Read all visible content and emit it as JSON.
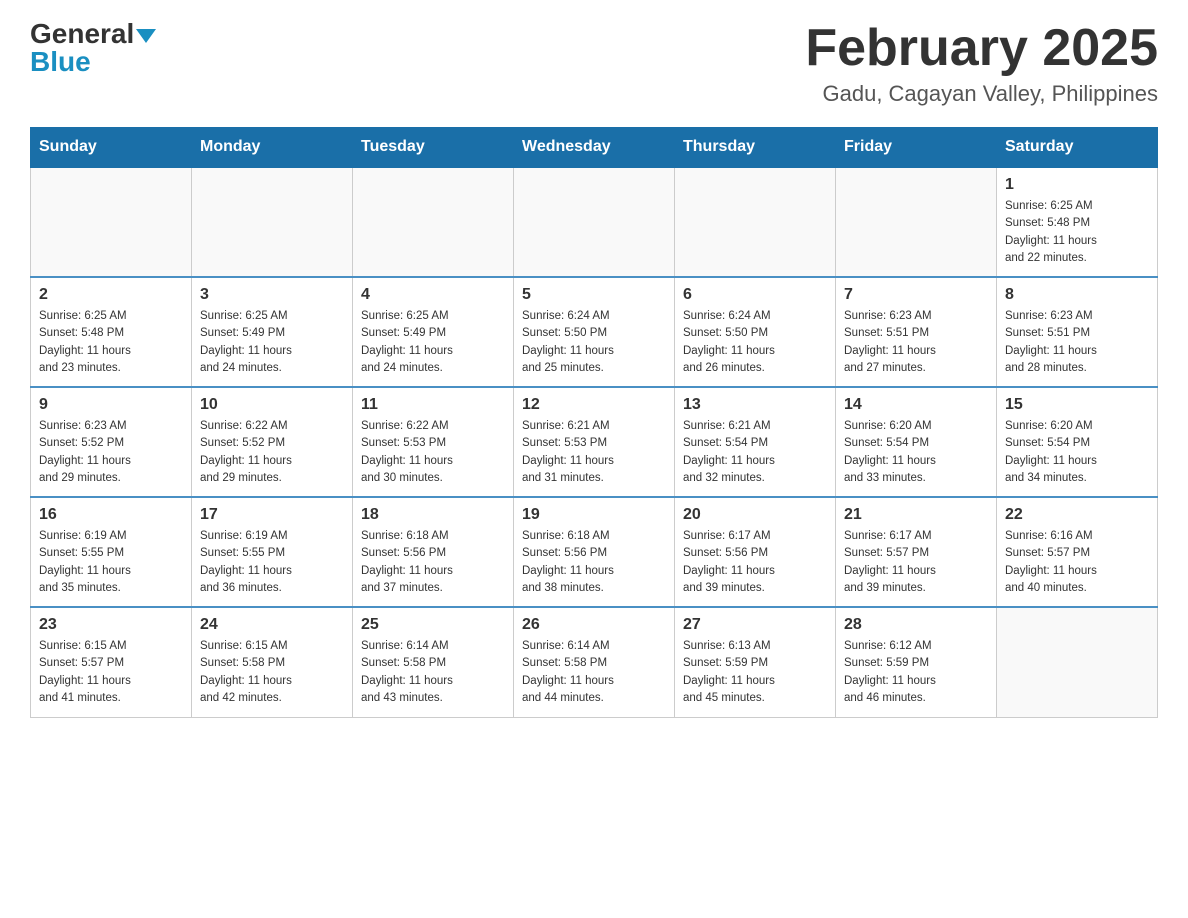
{
  "header": {
    "logo_general": "General",
    "logo_blue": "Blue",
    "month_title": "February 2025",
    "location": "Gadu, Cagayan Valley, Philippines"
  },
  "days_of_week": [
    "Sunday",
    "Monday",
    "Tuesday",
    "Wednesday",
    "Thursday",
    "Friday",
    "Saturday"
  ],
  "weeks": [
    [
      {
        "day": "",
        "info": ""
      },
      {
        "day": "",
        "info": ""
      },
      {
        "day": "",
        "info": ""
      },
      {
        "day": "",
        "info": ""
      },
      {
        "day": "",
        "info": ""
      },
      {
        "day": "",
        "info": ""
      },
      {
        "day": "1",
        "info": "Sunrise: 6:25 AM\nSunset: 5:48 PM\nDaylight: 11 hours\nand 22 minutes."
      }
    ],
    [
      {
        "day": "2",
        "info": "Sunrise: 6:25 AM\nSunset: 5:48 PM\nDaylight: 11 hours\nand 23 minutes."
      },
      {
        "day": "3",
        "info": "Sunrise: 6:25 AM\nSunset: 5:49 PM\nDaylight: 11 hours\nand 24 minutes."
      },
      {
        "day": "4",
        "info": "Sunrise: 6:25 AM\nSunset: 5:49 PM\nDaylight: 11 hours\nand 24 minutes."
      },
      {
        "day": "5",
        "info": "Sunrise: 6:24 AM\nSunset: 5:50 PM\nDaylight: 11 hours\nand 25 minutes."
      },
      {
        "day": "6",
        "info": "Sunrise: 6:24 AM\nSunset: 5:50 PM\nDaylight: 11 hours\nand 26 minutes."
      },
      {
        "day": "7",
        "info": "Sunrise: 6:23 AM\nSunset: 5:51 PM\nDaylight: 11 hours\nand 27 minutes."
      },
      {
        "day": "8",
        "info": "Sunrise: 6:23 AM\nSunset: 5:51 PM\nDaylight: 11 hours\nand 28 minutes."
      }
    ],
    [
      {
        "day": "9",
        "info": "Sunrise: 6:23 AM\nSunset: 5:52 PM\nDaylight: 11 hours\nand 29 minutes."
      },
      {
        "day": "10",
        "info": "Sunrise: 6:22 AM\nSunset: 5:52 PM\nDaylight: 11 hours\nand 29 minutes."
      },
      {
        "day": "11",
        "info": "Sunrise: 6:22 AM\nSunset: 5:53 PM\nDaylight: 11 hours\nand 30 minutes."
      },
      {
        "day": "12",
        "info": "Sunrise: 6:21 AM\nSunset: 5:53 PM\nDaylight: 11 hours\nand 31 minutes."
      },
      {
        "day": "13",
        "info": "Sunrise: 6:21 AM\nSunset: 5:54 PM\nDaylight: 11 hours\nand 32 minutes."
      },
      {
        "day": "14",
        "info": "Sunrise: 6:20 AM\nSunset: 5:54 PM\nDaylight: 11 hours\nand 33 minutes."
      },
      {
        "day": "15",
        "info": "Sunrise: 6:20 AM\nSunset: 5:54 PM\nDaylight: 11 hours\nand 34 minutes."
      }
    ],
    [
      {
        "day": "16",
        "info": "Sunrise: 6:19 AM\nSunset: 5:55 PM\nDaylight: 11 hours\nand 35 minutes."
      },
      {
        "day": "17",
        "info": "Sunrise: 6:19 AM\nSunset: 5:55 PM\nDaylight: 11 hours\nand 36 minutes."
      },
      {
        "day": "18",
        "info": "Sunrise: 6:18 AM\nSunset: 5:56 PM\nDaylight: 11 hours\nand 37 minutes."
      },
      {
        "day": "19",
        "info": "Sunrise: 6:18 AM\nSunset: 5:56 PM\nDaylight: 11 hours\nand 38 minutes."
      },
      {
        "day": "20",
        "info": "Sunrise: 6:17 AM\nSunset: 5:56 PM\nDaylight: 11 hours\nand 39 minutes."
      },
      {
        "day": "21",
        "info": "Sunrise: 6:17 AM\nSunset: 5:57 PM\nDaylight: 11 hours\nand 39 minutes."
      },
      {
        "day": "22",
        "info": "Sunrise: 6:16 AM\nSunset: 5:57 PM\nDaylight: 11 hours\nand 40 minutes."
      }
    ],
    [
      {
        "day": "23",
        "info": "Sunrise: 6:15 AM\nSunset: 5:57 PM\nDaylight: 11 hours\nand 41 minutes."
      },
      {
        "day": "24",
        "info": "Sunrise: 6:15 AM\nSunset: 5:58 PM\nDaylight: 11 hours\nand 42 minutes."
      },
      {
        "day": "25",
        "info": "Sunrise: 6:14 AM\nSunset: 5:58 PM\nDaylight: 11 hours\nand 43 minutes."
      },
      {
        "day": "26",
        "info": "Sunrise: 6:14 AM\nSunset: 5:58 PM\nDaylight: 11 hours\nand 44 minutes."
      },
      {
        "day": "27",
        "info": "Sunrise: 6:13 AM\nSunset: 5:59 PM\nDaylight: 11 hours\nand 45 minutes."
      },
      {
        "day": "28",
        "info": "Sunrise: 6:12 AM\nSunset: 5:59 PM\nDaylight: 11 hours\nand 46 minutes."
      },
      {
        "day": "",
        "info": ""
      }
    ]
  ]
}
